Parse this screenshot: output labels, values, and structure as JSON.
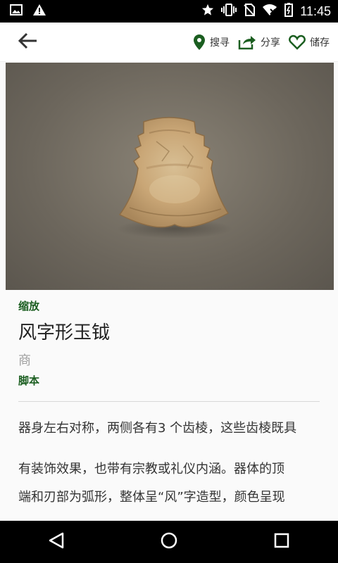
{
  "status": {
    "time": "11:45",
    "icons": [
      "image-icon",
      "warning-icon",
      "star-icon",
      "vibrate-icon",
      "no-sim-icon",
      "wifi-icon",
      "battery-icon"
    ]
  },
  "toolbar": {
    "back_icon": "arrow-left-icon",
    "search_label": "搜寻",
    "share_label": "分享",
    "save_label": "储存"
  },
  "detail": {
    "zoom_label": "缩放",
    "title": "风字形玉钺",
    "dynasty": "商",
    "script_label": "脚本",
    "paragraphs": [
      "器身左右对称，两侧各有3 个齿棱，这些齿棱既具",
      "有装饰效果，也带有宗教或礼仪内涵。器体的顶",
      "端和刃部为弧形，整体呈“风”字造型，颜色呈现"
    ]
  },
  "colors": {
    "accent_green": "#1b5e20",
    "hero_background": "#6c665c"
  }
}
